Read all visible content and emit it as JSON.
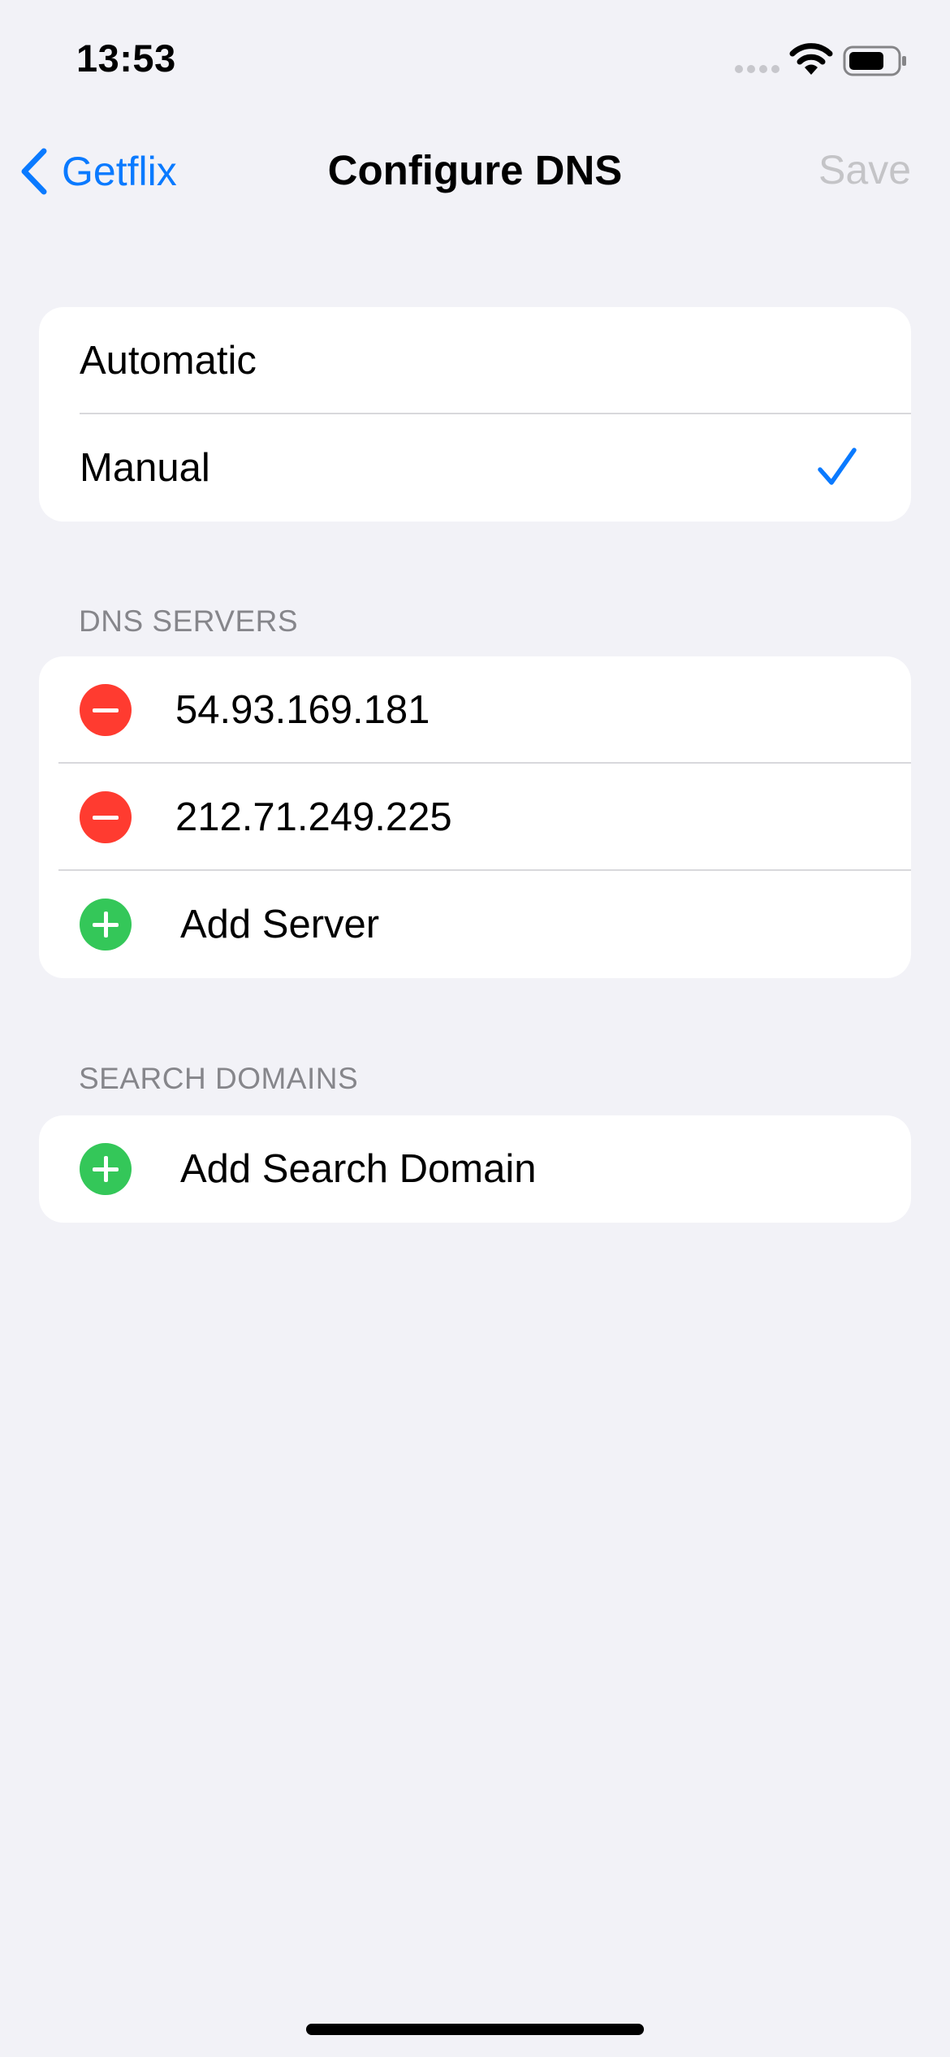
{
  "status_bar": {
    "time": "13:53",
    "icons": [
      "signal-icon",
      "wifi-icon",
      "battery-icon"
    ]
  },
  "nav": {
    "back_label": "Getflix",
    "title": "Configure DNS",
    "save_label": "Save",
    "back_icon": "chevron-left-icon"
  },
  "mode": {
    "options": [
      {
        "label": "Automatic",
        "selected": false
      },
      {
        "label": "Manual",
        "selected": true
      }
    ],
    "selected_icon": "checkmark-icon"
  },
  "dns_servers": {
    "header": "DNS SERVERS",
    "servers": [
      "54.93.169.181",
      "212.71.249.225"
    ],
    "add_label": "Add Server"
  },
  "search_domains": {
    "header": "SEARCH DOMAINS",
    "add_label": "Add Search Domain"
  },
  "colors": {
    "background": "#F2F2F7",
    "accent": "#0A7AFF",
    "remove": "#FF3B30",
    "add": "#34C759",
    "disabled": "#C4C4C7",
    "section_header": "#86868B"
  }
}
